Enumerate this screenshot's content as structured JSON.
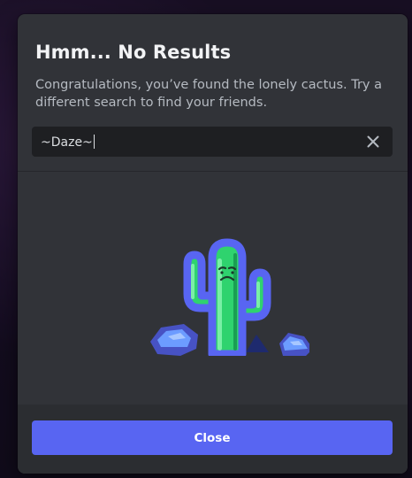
{
  "modal": {
    "title": "Hmm... No Results",
    "subtitle": "Congratulations, you’ve found the lonely cactus. Try a different search to find your friends.",
    "search": {
      "value": "~Daze~",
      "clear_icon": "close-icon"
    },
    "illustration": "sad-cactus",
    "close_label": "Close"
  },
  "colors": {
    "modal_bg": "#313338",
    "input_bg": "#1e1f22",
    "primary": "#5865f2",
    "title": "#f2f3f5",
    "subtitle": "#b5bac1"
  }
}
